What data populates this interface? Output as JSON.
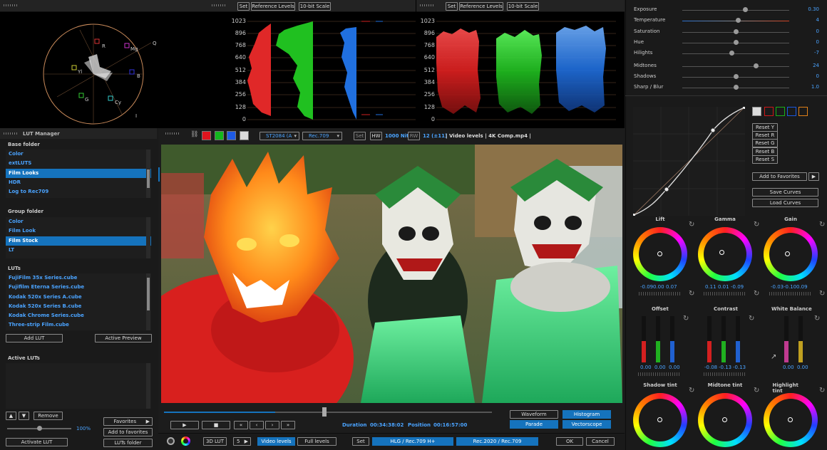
{
  "scopes": {
    "set_label": "Set",
    "ref_levels_label": "Reference Levels",
    "scale_label": "10-bit Scale",
    "level_labels": [
      "1023",
      "896",
      "768",
      "640",
      "512",
      "384",
      "256",
      "128",
      "0"
    ],
    "vectorscope_labels": [
      "R",
      "Mg",
      "B",
      "Cy",
      "G",
      "Yl",
      "Q",
      "I"
    ]
  },
  "lut_manager": {
    "title": "LUT Manager",
    "base_folder": {
      "title": "Base folder",
      "items": [
        "Color",
        "extLUTS",
        "Film Looks",
        "HDR",
        "Log to Rec709"
      ],
      "selected": 2
    },
    "group_folder": {
      "title": "Group folder",
      "items": [
        "Color",
        "Film Look",
        "Film Stock",
        "LT"
      ],
      "selected": 2
    },
    "luts": {
      "title": "LUTs",
      "items": [
        "FujiFilm 35x Series.cube",
        "Fujifilm Eterna Series.cube",
        "Kodak 520x Series A.cube",
        "Kodak 520x Series B.cube",
        "Kodak Chrome Series.cube",
        "Three-strip Film.cube"
      ]
    },
    "add_lut": "Add LUT",
    "active_preview": "Active Preview",
    "active_luts_title": "Active LUTs",
    "remove": "Remove",
    "favorites": "Favorites",
    "add_to_favorites": "Add to favorites",
    "percent": "100%",
    "activate_lut": "Activate LUT",
    "luts_folder": "LUTs folder"
  },
  "viewer_toolbar": {
    "colors": [
      "#e0141e",
      "#14b81e",
      "#1e5be6",
      "#dcdcdc"
    ],
    "transfer": "ST2084 (A",
    "gamut": "Rec.709",
    "set": "Set",
    "hw": "HW",
    "nits": "1000 Nits",
    "rw": "RW",
    "bits": "12 (±11)",
    "info": "| Video levels | 4K Comp.mp4 |"
  },
  "transport": {
    "duration_label": "Duration",
    "duration": "00:34:38:02",
    "position_label": "Position",
    "position": "00:16:57:00",
    "play_fraction": 0.34
  },
  "scope_buttons": {
    "waveform": "Waveform",
    "histogram": "Histogram",
    "parade": "Parade",
    "vectorscope": "Vectorscope"
  },
  "bottom_bar": {
    "lut3d": "3D LUT",
    "num": "5",
    "video_levels": "Video levels",
    "full_levels": "Full levels",
    "set": "Set",
    "hlg": "HLG / Rec.709 H+",
    "rec2020": "Rec.2020 / Rec.709",
    "ok": "OK",
    "cancel": "Cancel"
  },
  "adjustments": [
    {
      "name": "Exposure",
      "value": "0.30",
      "fraction": 0.59
    },
    {
      "name": "Temperature",
      "value": "4",
      "fraction": 0.52
    },
    {
      "name": "Saturation",
      "value": "0",
      "fraction": 0.5
    },
    {
      "name": "Hue",
      "value": "0",
      "fraction": 0.5
    },
    {
      "name": "Hilights",
      "value": "-7",
      "fraction": 0.46
    },
    {
      "name": "Midtones",
      "value": "24",
      "fraction": 0.69
    },
    {
      "name": "Shadows",
      "value": "0",
      "fraction": 0.5
    },
    {
      "name": "Sharp / Blur",
      "value": "1.0",
      "fraction": 0.5
    }
  ],
  "curves": {
    "swatches": [
      "#dcdcdc",
      "#d01818",
      "#18b018",
      "#1c58e0",
      "#e08018"
    ],
    "reset_y": "Reset Y",
    "reset_r": "Reset R",
    "reset_g": "Reset G",
    "reset_b": "Reset B",
    "reset_s": "Reset S",
    "add_to_favorites": "Add to Favorites",
    "save_curves": "Save Curves",
    "load_curves": "Load Curves"
  },
  "wheels_top": [
    {
      "name": "Lift",
      "values": [
        "-0.09",
        "0.00",
        "0.07"
      ]
    },
    {
      "name": "Gamma",
      "values": [
        "0.11",
        "0.01",
        "-0.09"
      ]
    },
    {
      "name": "Gain",
      "values": [
        "-0.03",
        "-0.10",
        "0.09"
      ]
    }
  ],
  "offset": {
    "name": "Offset",
    "values": [
      "0.00",
      "0.00",
      "0.00"
    ]
  },
  "contrast": {
    "name": "Contrast",
    "values": [
      "-0.08",
      "-0.13",
      "-0.13"
    ]
  },
  "white_balance": {
    "name": "White Balance",
    "values": [
      "0.00",
      "0.00"
    ]
  },
  "wheels_bottom": [
    {
      "name": "Shadow tint"
    },
    {
      "name": "Midtone tint"
    },
    {
      "name": "Highlight tint"
    }
  ]
}
